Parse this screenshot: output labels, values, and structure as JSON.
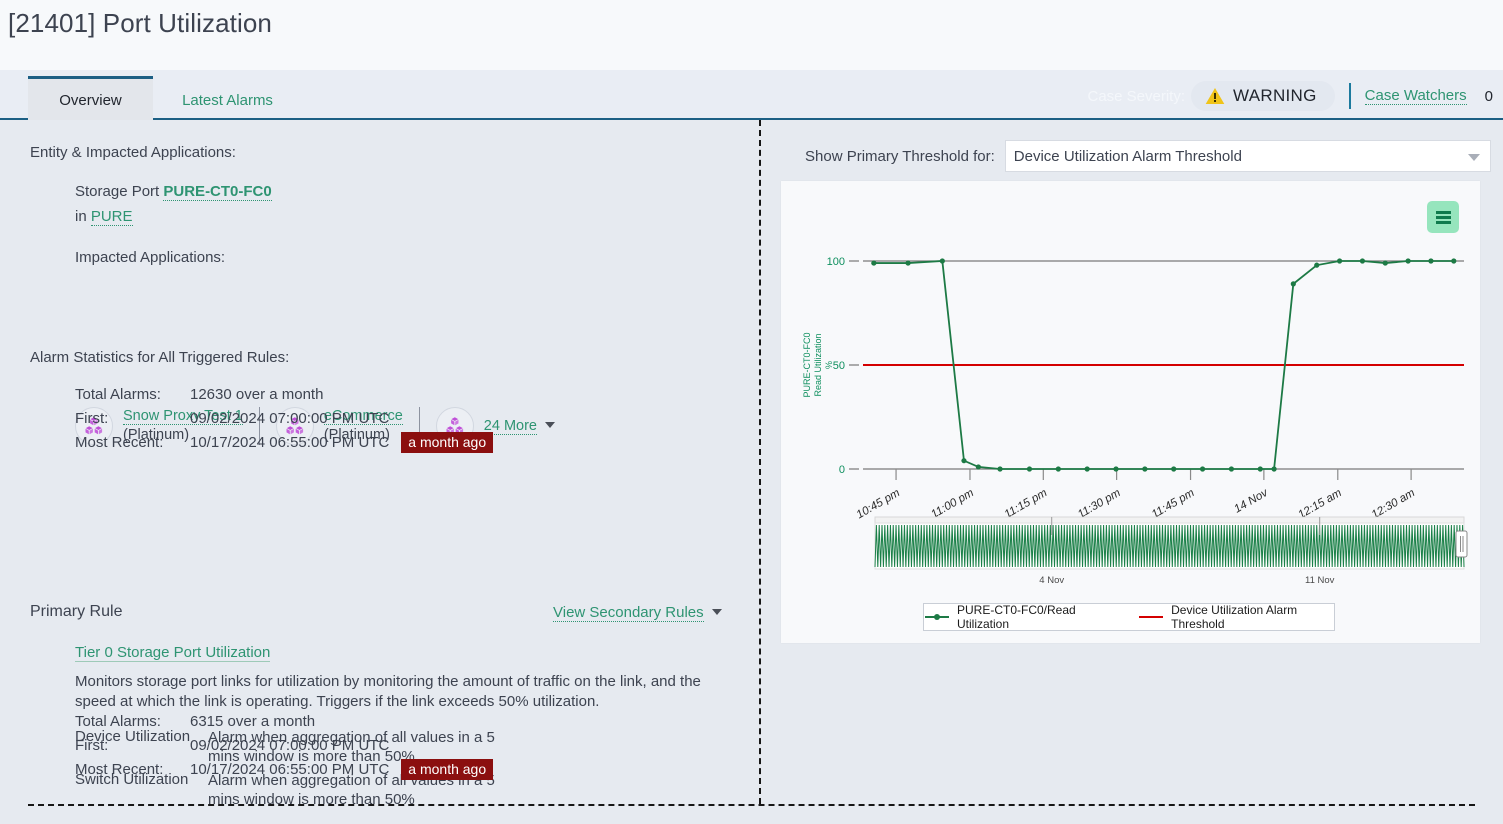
{
  "page": {
    "title": "[21401] Port Utilization"
  },
  "tabs": [
    {
      "label": "Overview",
      "active": true
    },
    {
      "label": "Latest Alarms",
      "active": false
    }
  ],
  "header": {
    "severity_label": "Case Severity:",
    "severity_value": "WARNING",
    "severity_icon": "warning-triangle-icon",
    "watchers_label": "Case Watchers",
    "watchers_count": "0"
  },
  "left": {
    "entity_section_title": "Entity & Impacted Applications:",
    "entity_prefix": "Storage Port ",
    "entity_name": "PURE-CT0-FC0",
    "entity_in_prefix": "in ",
    "entity_in_name": "PURE",
    "impacted_apps_title": "Impacted Applications:",
    "apps": [
      {
        "name": "Snow Proxy Test 1",
        "tier": "(Platinum)",
        "icon": "cubes-icon"
      },
      {
        "name": "eCommerce",
        "tier": "(Platinum)",
        "icon": "cubes-icon"
      },
      {
        "name": "24 More",
        "tier": "",
        "icon": "cubes-icon"
      }
    ],
    "alarm_stats_title": "Alarm Statistics for All Triggered Rules:",
    "alarm_stats": [
      {
        "key": "Total Alarms:",
        "value": "12630 over a month",
        "badge": ""
      },
      {
        "key": "First:",
        "value": "09/02/2024 07:00:00 PM UTC",
        "badge": ""
      },
      {
        "key": "Most Recent:",
        "value": "10/17/2024 06:55:00 PM UTC",
        "badge": "a month ago"
      }
    ],
    "primary_rule_title": "Primary Rule",
    "view_secondary_rules": "View Secondary Rules",
    "rule_name": "Tier 0 Storage Port Utilization",
    "rule_description": "Monitors storage port links for utilization by monitoring the amount of traffic on the link, and the speed at which the link is operating. Triggers if the link exceeds 50% utilization.",
    "utilization_rows": [
      {
        "key": "Device Utilization",
        "value": "Alarm when aggregation of all values in a 5 mins window is more than 50%"
      },
      {
        "key": "Switch Utilization",
        "value": "Alarm when aggregation of all values in a 5 mins window is more than 50%"
      }
    ],
    "rule_stats": [
      {
        "key": "Total Alarms:",
        "value": "6315 over a month",
        "badge": ""
      },
      {
        "key": "First:",
        "value": "09/02/2024 07:00:00 PM UTC",
        "badge": ""
      },
      {
        "key": "Most Recent:",
        "value": "10/17/2024 06:55:00 PM UTC",
        "badge": "a month ago"
      }
    ]
  },
  "right": {
    "threshold_label": "Show Primary Threshold for:",
    "threshold_selected": "Device Utilization Alarm Threshold",
    "chart_menu_icon": "hamburger-menu-icon",
    "navigator": {
      "left_tick_label": "4 Nov",
      "right_tick_label": "11 Nov"
    }
  },
  "chart_data": {
    "type": "line",
    "title": "",
    "xlabel": "",
    "ylabel": "PURE-CT0-FC0 Read Utilization %",
    "ylabel_lines": [
      "PURE-CT0-FC0",
      "Read Utilization",
      "%"
    ],
    "ylim": [
      0,
      100
    ],
    "yticks": [
      0,
      50,
      100
    ],
    "xtick_labels": [
      "10:45 pm",
      "11:00 pm",
      "11:15 pm",
      "11:30 pm",
      "11:45 pm",
      "14 Nov",
      "12:15 am",
      "12:30 am"
    ],
    "xtick_positions": [
      0.055,
      0.178,
      0.3,
      0.422,
      0.545,
      0.667,
      0.79,
      0.912
    ],
    "grid": false,
    "legend_position": "bottom",
    "series": [
      {
        "name": "PURE-CT0-FC0/Read Utilization",
        "color": "#1d7a45",
        "marker": "circle",
        "x": [
          0.018,
          0.075,
          0.132,
          0.168,
          0.192,
          0.228,
          0.277,
          0.325,
          0.373,
          0.421,
          0.469,
          0.517,
          0.565,
          0.613,
          0.661,
          0.684,
          0.716,
          0.755,
          0.793,
          0.831,
          0.869,
          0.907,
          0.945,
          0.983
        ],
        "y": [
          99,
          99,
          100,
          4,
          1,
          0,
          0,
          0,
          0,
          0,
          0,
          0,
          0,
          0,
          0,
          0,
          89,
          98,
          100,
          100,
          99,
          100,
          100,
          100
        ]
      },
      {
        "name": "Device Utilization Alarm Threshold",
        "color": "#d40000",
        "marker": "none",
        "constant_y": 50
      }
    ],
    "legend": [
      {
        "label": "PURE-CT0-FC0/Read Utilization",
        "color": "#1d7a45",
        "style": "line-marker"
      },
      {
        "label": "Device Utilization Alarm Threshold",
        "color": "#d40000",
        "style": "line"
      }
    ]
  }
}
